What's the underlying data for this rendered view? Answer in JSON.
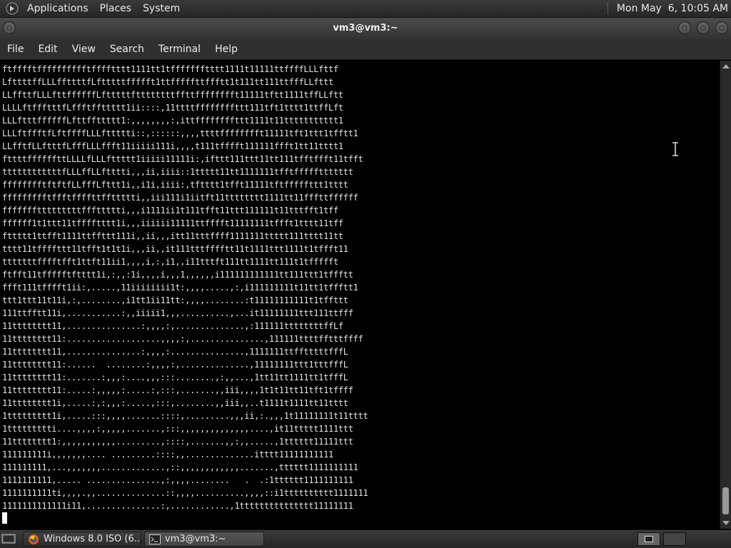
{
  "top_panel": {
    "app_icon": "gnome-foot-icon",
    "menus": [
      "Applications",
      "Places",
      "System"
    ],
    "clock": "Mon May  6, 10:05 AM"
  },
  "window": {
    "title": "vm3@vm3:~",
    "buttons": [
      "window-menu-icon",
      "minimize-icon",
      "maximize-icon",
      "close-icon"
    ]
  },
  "menubar": {
    "items": [
      "File",
      "Edit",
      "View",
      "Search",
      "Terminal",
      "Help"
    ]
  },
  "terminal": {
    "lines": [
      "ftfffftfffffffffftfffftttt1111tt1tffffffftttt1111t11111ttffffLLLfttf",
      "LfttttffLLLffttttfLftttttffffft1ttfffffttffftt1t111tt111ttfffLLfttt",
      "LLffttfLLLfttffffffLftttttfttttttttffttfffffffft11111tftt1111tffLLftt",
      "LLLLftffftttfLffftffttttt1ii::::,11ttttffffffffttt111tft1tttt1ttffLft",
      "LLLftttffffffLfttffttttt1:,,,,,,,,:,ittffffffffttt1111t11ttttttttttt1",
      "LLLftffftfLftffffLLLfttttti::,::::::,,,,ttttfffffffft11111tft1ttt1tfftt1",
      "LLfftfLLftttfLfffLLLffft11iiiii111i,,,,t111tfffft111111ffft1tt11tttt1",
      "fttttffffffttLLLLfLLLfttttt1iiiii11111i:,ifttt111ttt11tt111tfftffft11tfft",
      "ttttttttttttfLLLffLLftttti,,,ii,iiii::1ttttt11tt1111111tfftfffffttttttt",
      "fffffffftftftfLLfffLfttt1i,,i1i,iiii:,tftttt1tfft11111tftfffffttt1tttt",
      "ffffffffftffftffffttffttttti,,iii111i1iitft11tttttttt1111tt11fffttffffff",
      "ffffffftttttttttfffttttti,,,i1111ii1t111tfft11ttt111111t11tttfft1tff",
      "ffffff1t1ttt11tfffftttt1i,,,iiiiii11111ttfffft11111111tffft1tttt11tff",
      "fttttt1ttfft1111ttffttt111i,,ii,,,itt11tttffff1111111ttttt111tttt11tt",
      "tttt11tffffttt11tfft1t1t1i,,,ii,,it111tttfffftt11t1111ttt1111t1tffft11",
      "tttttttfffftfft1ttft11ii1,,,,i,:,i1,,i11tttft111tt1111tt111t1tffffft",
      "ftfft11tffffftftttt1i,:,,:1i,,,,i,,,1,,,,,,i111111111111tt111ttt1tffftt",
      "ffft111tfffft1ii:,.....,11iiiiiiii1t:,,,,.....,:,i111111111t11tt1tffftt1",
      "ttt1ttt11t11i,:,........,i1tt1ii11tt:,,,,........:t11111111111t1tffttt",
      "111ttfftt11i,...........:,,iiiii1,,,..........,...it11111111ttt111ttfff",
      "11tttttttt11,...............:,,,,:,..............,:111111ttttttttffLf",
      "11tttttttt11:...................,,,,:,...............,111111ttttfftttffff",
      "11tttttttt11,...............:,,,,:...............,1111111ttfftttttfffL",
      "11tttttttt11:......  ........:,,,,:,..............,11111111ttt1tttfffL",
      "11tttttttt11:.......:,,,:....,,,:::........,:,,...,1tt11tt1111tt1tfffL",
      "11tttttttt11:.....:,,,,,:.....:,:::,.......,,iii,,,,1t1t11tt11tft1tffff",
      "11tttttttt1i,.....:,:,,,:.....,:::,........,,iii,,..t1111t1111tt11tttt",
      "1ttttttttt1i,.....:::,,,,.......::::,.........,,,ii,:.,,,1t11111111t11tttt",
      "1ttttttttti....,,,,:,,,,,.......,:::,,,,,,,,,,,,,,....,it11ttttt1111ttt",
      "11tttttttt1:,,,,,,,,,,,.........,::::,.......,,:,,.....,1tttttt11111ttt",
      "111111111i,,,,,,,.... .........::::,,..............itttt11111111111",
      "111111111,...,,,,,,,.............,::,,,,,,,,,,,,.......,tttttt1111111111",
      "1111111111,..... ...............,:,,,,........   .  .:1tttttt1111111111",
      "1111111111ti,,,,.,,..............::,,,,..........,,,,::i1tttttttttt1111111",
      "1111111111111i11,...............:,............,1ttttttttttttttt11111111"
    ]
  },
  "taskbar": {
    "show_desktop_icon": "show-desktop-icon",
    "tasks": [
      {
        "label": "Windows 8.0 ISO (6...",
        "icon": "firefox-icon"
      },
      {
        "label": "vm3@vm3:~",
        "icon": "terminal-icon"
      }
    ]
  }
}
